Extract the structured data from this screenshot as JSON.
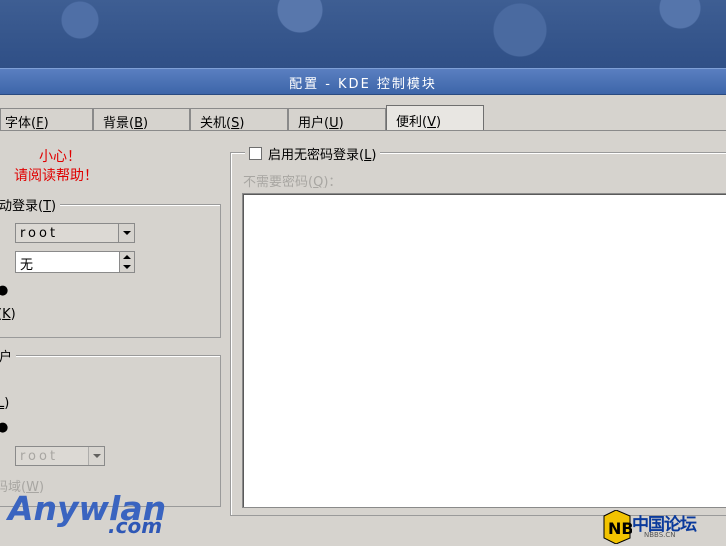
{
  "window": {
    "title": "配置 - KDE 控制模块"
  },
  "tabs": [
    {
      "label": "字体(",
      "key": "F",
      "close": ")"
    },
    {
      "label": "背景(",
      "key": "B",
      "close": ")"
    },
    {
      "label": "关机(",
      "key": "S",
      "close": ")"
    },
    {
      "label": "用户(",
      "key": "U",
      "close": ")"
    },
    {
      "label": "便利(",
      "key": "V",
      "close": ")"
    }
  ],
  "warning": {
    "line1": "小心！",
    "line2": "请阅读帮助！"
  },
  "autologin": {
    "legend_text": "动登录(",
    "legend_key": "T",
    "legend_close": ")",
    "user_value": "root",
    "delay_value": "无",
    "k_label_open": "(",
    "k_key": "K",
    "k_close": ")"
  },
  "user_group": {
    "legend": "户",
    "l_key": "L",
    "l_close": ")",
    "user_value": "root",
    "w_label": "码域(",
    "w_key": "W",
    "w_close": ")"
  },
  "passwordless": {
    "checkbox_label": "启用无密码登录(",
    "checkbox_key": "L",
    "checkbox_close": ")",
    "noneed_label": "不需要密码(",
    "noneed_key": "Q",
    "noneed_close": ")："
  },
  "watermarks": {
    "anywlan_a": "Anywlan",
    "anywlan_b": ".com",
    "nb_text": "中国论坛",
    "nb_sub": "NBBS.CN"
  }
}
